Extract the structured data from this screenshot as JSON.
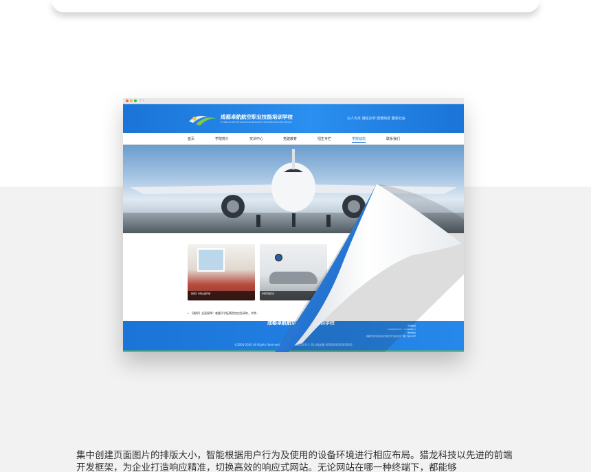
{
  "site": {
    "school_name": "成都卓航航空职业技能培训学校",
    "school_name_en": "CHENGDUZHUOHANGHANGKONGZHIYEJINENGPEIXUNXUEXIAO",
    "slogan": "以人为本 诚信办学 鼎德尚技 服务社会",
    "nav": [
      "首页",
      "学院简介",
      "实训中心",
      "党建教育",
      "招生专栏",
      "学院动态",
      "联系我们"
    ],
    "active_nav": "学院动态",
    "news_images": [
      {
        "caption": "【通知】学院全面开展"
      },
      {
        "caption": "学院开展实训"
      }
    ],
    "news_list": [
      "【通知】全面保障！着重开学疫情防控应急演练，学院...",
      "【学院公告】新增培训项目，简短需要！教育局...",
      "【通知】开学在即，如何认真再来...",
      "【日前播】那件得..."
    ],
    "footer": {
      "title": "成都卓航航空职业技能培训学校",
      "contact_lines": [
        "咨询电话",
        "13880807007 / 13880807x",
        "学校地址",
        "成都市天府新区航空港经济开发区双华一路一段XXX号"
      ],
      "copyright": "©2004-2020 All Rights Reserved 蜀ICP备15096554号-1 四川网安备 00000000000000号"
    }
  },
  "description": "集中创建页面图片的排版大小，智能根据用户行为及使用的设备环境进行相应布局。猎龙科技以先进的前端开发框架，为企业打造响应精准，切换高效的响应式网站。无论网站在哪一种终端下，都能够",
  "colors": {
    "accent": "#1b74d8",
    "band": "#f2f2f2",
    "green": "#6ac13f"
  }
}
